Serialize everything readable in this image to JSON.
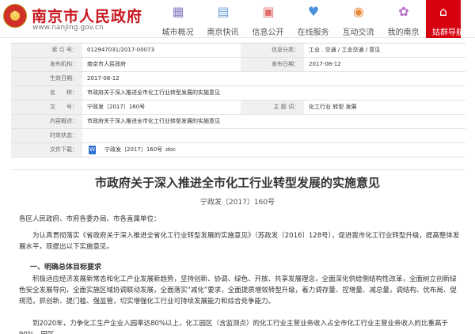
{
  "header": {
    "site_title": "南京市人民政府",
    "site_url": "www.nanjing.gov.cn",
    "nav": [
      {
        "label": "城市概况",
        "icon": "city-overview-icon",
        "glyph": "▦",
        "color": "#8a7fc2"
      },
      {
        "label": "南京快讯",
        "icon": "news-icon",
        "glyph": "▤",
        "color": "#6fa0d8"
      },
      {
        "label": "信息公开",
        "icon": "info-disclosure-icon",
        "glyph": "▣",
        "color": "#e36b6b"
      },
      {
        "label": "在线服务",
        "icon": "online-service-icon",
        "glyph": "♥",
        "color": "#4a8fd8"
      },
      {
        "label": "互动交流",
        "icon": "interaction-icon",
        "glyph": "◉",
        "color": "#e88a3c"
      },
      {
        "label": "我的南京",
        "icon": "my-nanjing-icon",
        "glyph": "✿",
        "color": "#b86fc9"
      },
      {
        "label": "姑群导航",
        "icon": "navigation-icon",
        "glyph": "⌂",
        "color": "#ffffff"
      }
    ]
  },
  "info": {
    "index_label": "索 引 号：",
    "index_value": "012947031/2017-00073",
    "category_label": "信息分类：",
    "category_value": "工业 . 交通 / 工业交通 / 意见",
    "issuer_label": "发布机构：",
    "issuer_value": "南京市人民政府",
    "publish_date_label": "发布日期：",
    "publish_date_value": "2017-08-12",
    "effective_date_label": "生效日期：",
    "effective_date_value": "2017-08-12",
    "name_label": "名　　称：",
    "name_value": "市政府关于深入推进全市化工行业转型发展的实施意见",
    "doc_no_label": "文　　号：",
    "doc_no_value": "宁政发〔2017〕160号",
    "keywords_label": "主 题 词：",
    "keywords_value": "化工行业 转型 发展",
    "content_summary_label": "内容概述：",
    "content_summary_value": "市政府关于深入推进全市化工行业转型发展的实施意见",
    "expiry_label": "时效状态：",
    "expiry_value": "",
    "attachment_label": "文件下载：",
    "attachment_value": "宁政发〔2017〕160号 .doc"
  },
  "article": {
    "title": "市政府关于深入推进全市化工行业转型发展的实施意见",
    "doc_number": "宁政发〔2017〕160号",
    "addressees": "各区人民政府、市府各委办局、市各直属单位：",
    "intro": "为认真贯彻落实《省政府关于深入推进全省化工行业转型发展的实施意见》（苏政发〔2016〕128号），促进我市化工行业转型升级，提高整体发展水平，现提出以下实施意见。",
    "section_1": "一、明确总体目标要求",
    "body_1": "积极适应经济发展新常态和化工产业发展新趋势，坚持创新、协调、绿色、开放、共享发展理念，全面深化供给侧结构性改革，全面树立创新绿色安全发展导向，全面实施区域协调联动发展，全面落实“减化”要求，全面提质增效转型升级，着力调存量、控增量、减总量，调结构、优布局、促规范，抓创新、提门槛、强监管，切实增强化工行业可持续发展能力和综合竞争能力。",
    "body_2": "到2020年，力争化工生产企业入园率达80%以上，化工园区（含监测点）的化工行业主营业务收入占全市化工行业主营业务收入的比重高于90%，园区"
  }
}
